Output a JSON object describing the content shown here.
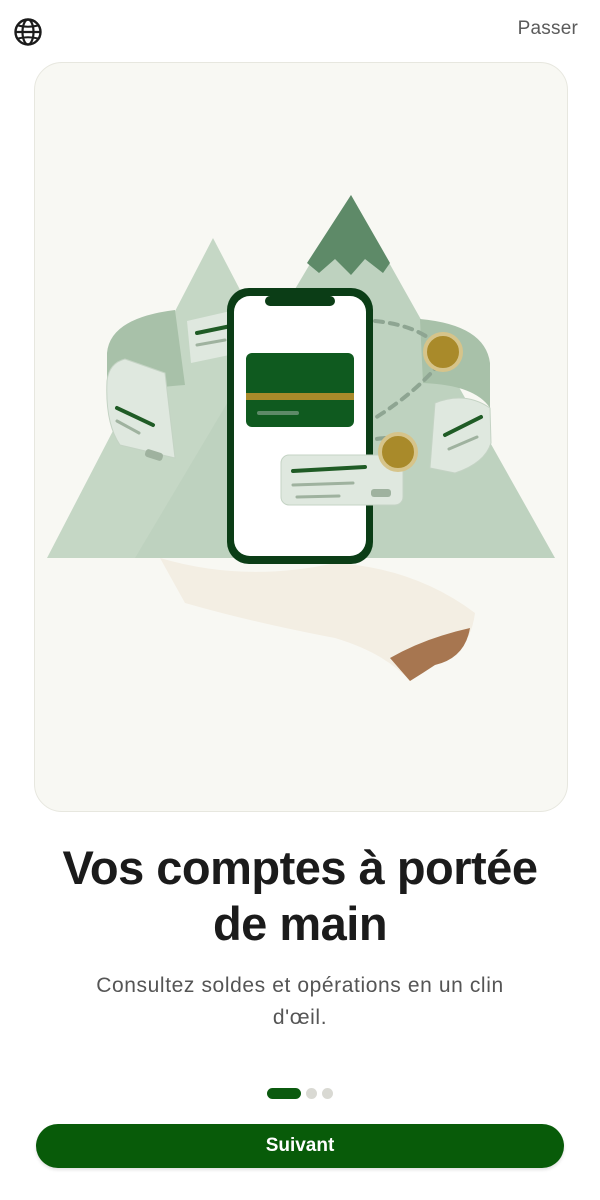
{
  "header": {
    "language_icon": "globe-icon",
    "skip_label": "Passer"
  },
  "slide": {
    "title": "Vos comptes à portée de main",
    "subtitle": "Consultez soldes et opérations en un clin d'œil.",
    "illustration": "phone-with-bank-card-illustration"
  },
  "pagination": {
    "total": 3,
    "active_index": 0
  },
  "actions": {
    "next_label": "Suivant"
  },
  "colors": {
    "primary": "#085b09",
    "mountain": "#c3d6c3",
    "mountain_dark": "#5f8b69",
    "coin": "#a98a2a",
    "card_background": "#f8f8f3"
  }
}
